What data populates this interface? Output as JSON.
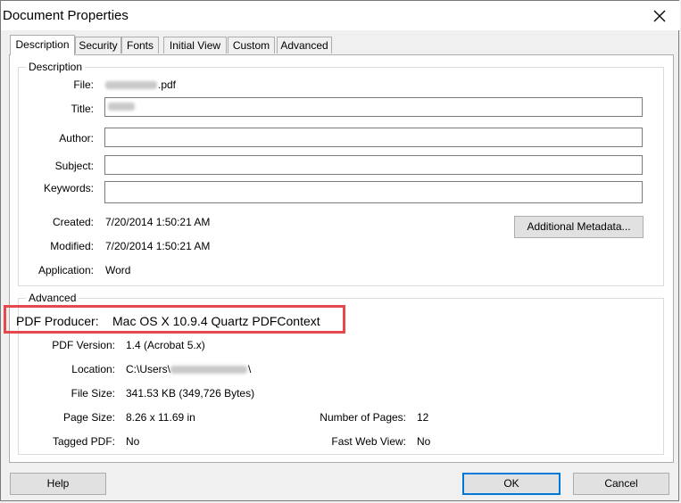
{
  "window": {
    "title": "Document Properties"
  },
  "tabs": [
    {
      "label": "Description",
      "active": true
    },
    {
      "label": "Security",
      "active": false
    },
    {
      "label": "Fonts",
      "active": false
    },
    {
      "label": "Initial View",
      "active": false
    },
    {
      "label": "Custom",
      "active": false
    },
    {
      "label": "Advanced",
      "active": false
    }
  ],
  "description": {
    "legend": "Description",
    "file_label": "File:",
    "file_ext": ".pdf",
    "title_label": "Title:",
    "author_label": "Author:",
    "author_value": "",
    "subject_label": "Subject:",
    "subject_value": "",
    "keywords_label": "Keywords:",
    "keywords_value": "",
    "created_label": "Created:",
    "created_value": "7/20/2014 1:50:21 AM",
    "modified_label": "Modified:",
    "modified_value": "7/20/2014 1:50:21 AM",
    "application_label": "Application:",
    "application_value": "Word",
    "metadata_button": "Additional Metadata..."
  },
  "advanced": {
    "legend": "Advanced",
    "producer_label": "PDF Producer:",
    "producer_value": "Mac OS X 10.9.4 Quartz PDFContext",
    "version_label": "PDF Version:",
    "version_value": "1.4 (Acrobat 5.x)",
    "location_label": "Location:",
    "location_prefix": "C:\\Users\\",
    "location_suffix": "\\",
    "filesize_label": "File Size:",
    "filesize_value": "341.53 KB (349,726 Bytes)",
    "pagesize_label": "Page Size:",
    "pagesize_value": "8.26 x 11.69 in",
    "numpages_label": "Number of Pages:",
    "numpages_value": "12",
    "tagged_label": "Tagged PDF:",
    "tagged_value": "No",
    "fastweb_label": "Fast Web View:",
    "fastweb_value": "No"
  },
  "buttons": {
    "help": "Help",
    "ok": "OK",
    "cancel": "Cancel"
  },
  "colors": {
    "highlight": "#e5484d",
    "focus": "#0078d7"
  }
}
